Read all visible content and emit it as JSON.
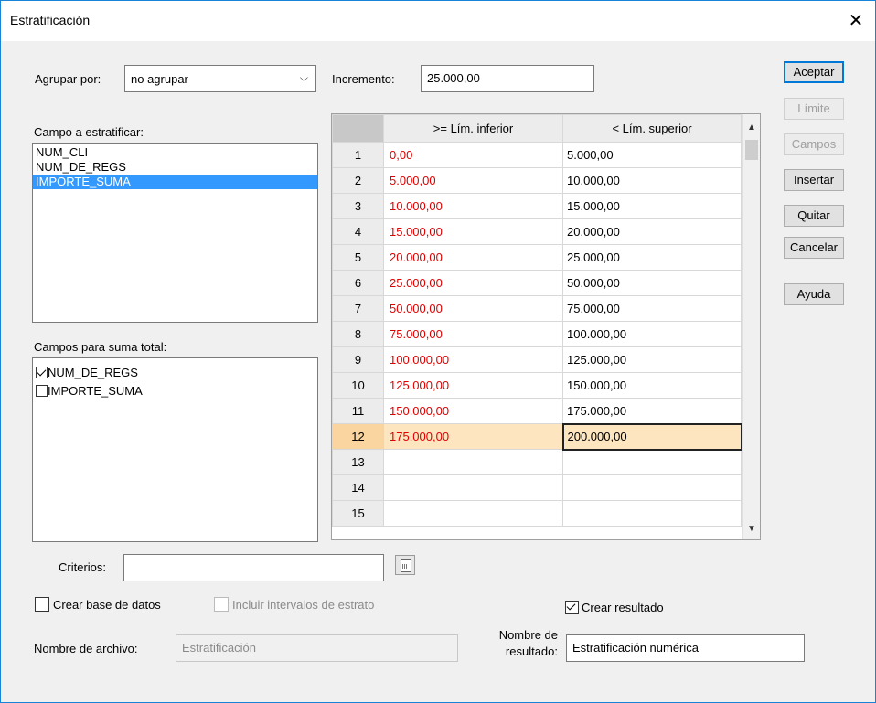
{
  "window": {
    "title": "Estratificación",
    "close": "✕"
  },
  "group_by": {
    "label": "Agrupar por:",
    "value": "no agrupar",
    "arrow": "⌵"
  },
  "increment": {
    "label": "Incremento:",
    "value": "25.000,00"
  },
  "field_to_stratify": {
    "label": "Campo a estratificar:",
    "items": [
      "NUM_CLI",
      "NUM_DE_REGS",
      "IMPORTE_SUMA"
    ],
    "selected_index": 2
  },
  "total_fields": {
    "label": "Campos para suma total:",
    "items": [
      {
        "label": "NUM_DE_REGS",
        "checked": true
      },
      {
        "label": "IMPORTE_SUMA",
        "checked": false
      }
    ]
  },
  "grid": {
    "col_lower": ">= Lím. inferior",
    "col_upper": "< Lím. superior",
    "rows": [
      {
        "n": "1",
        "lo": "0,00",
        "hi": "5.000,00"
      },
      {
        "n": "2",
        "lo": "5.000,00",
        "hi": "10.000,00"
      },
      {
        "n": "3",
        "lo": "10.000,00",
        "hi": "15.000,00"
      },
      {
        "n": "4",
        "lo": "15.000,00",
        "hi": "20.000,00"
      },
      {
        "n": "5",
        "lo": "20.000,00",
        "hi": "25.000,00"
      },
      {
        "n": "6",
        "lo": "25.000,00",
        "hi": "50.000,00"
      },
      {
        "n": "7",
        "lo": "50.000,00",
        "hi": "75.000,00"
      },
      {
        "n": "8",
        "lo": "75.000,00",
        "hi": "100.000,00"
      },
      {
        "n": "9",
        "lo": "100.000,00",
        "hi": "125.000,00"
      },
      {
        "n": "10",
        "lo": "125.000,00",
        "hi": "150.000,00"
      },
      {
        "n": "11",
        "lo": "150.000,00",
        "hi": "175.000,00"
      },
      {
        "n": "12",
        "lo": "175.000,00",
        "hi": "200.000,00"
      },
      {
        "n": "13",
        "lo": "",
        "hi": ""
      },
      {
        "n": "14",
        "lo": "",
        "hi": ""
      },
      {
        "n": "15",
        "lo": "",
        "hi": ""
      }
    ],
    "current_row": 11
  },
  "buttons": {
    "accept": "Aceptar",
    "limit": "Límite",
    "fields": "Campos",
    "insert": "Insertar",
    "remove": "Quitar",
    "cancel": "Cancelar",
    "help": "Ayuda"
  },
  "criteria": {
    "label": "Criterios:",
    "value": ""
  },
  "create_db": {
    "label": "Crear base de datos",
    "checked": false
  },
  "include_intervals": {
    "label": "Incluir intervalos de estrato",
    "checked": false
  },
  "create_result": {
    "label": "Crear resultado",
    "checked": true
  },
  "file_name": {
    "label": "Nombre de archivo:",
    "value": "Estratificación"
  },
  "result_name": {
    "label_line1": "Nombre de",
    "label_line2": "resultado:",
    "value": "Estratificación numérica"
  },
  "colors": {
    "accent": "#0078d7",
    "selection": "#3399ff",
    "lower_text": "#e00000",
    "current_row": "#fde5c0"
  }
}
